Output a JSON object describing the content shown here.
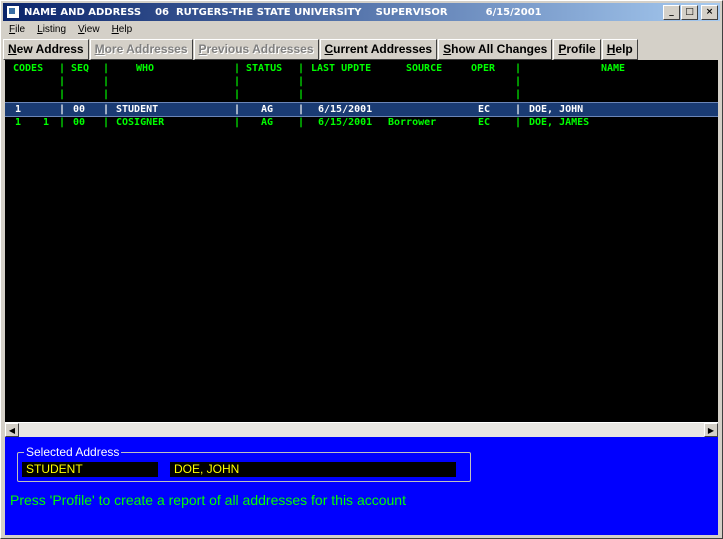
{
  "window": {
    "title_segments": [
      "NAME AND ADDRESS",
      "06  RUTGERS-THE STATE UNIVERSITY",
      "SUPERVISOR",
      "6/15/2001"
    ],
    "controls": {
      "minimize": "_",
      "maximize": "□",
      "close": "×"
    }
  },
  "menu": {
    "items": [
      {
        "u": "F",
        "rest": "ile"
      },
      {
        "u": "L",
        "rest": "isting"
      },
      {
        "u": "V",
        "rest": "iew"
      },
      {
        "u": "H",
        "rest": "elp"
      }
    ]
  },
  "toolbar": {
    "buttons": [
      {
        "u": "N",
        "rest": "ew Address",
        "enabled": true
      },
      {
        "u": "M",
        "rest": "ore Addresses",
        "enabled": false
      },
      {
        "u": "P",
        "rest": "revious Addresses",
        "enabled": false
      },
      {
        "u": "C",
        "rest": "urrent Addresses",
        "enabled": true
      },
      {
        "u": "S",
        "rest": "how All Changes",
        "enabled": true
      },
      {
        "u": "P",
        "rest": "rofile",
        "enabled": true
      },
      {
        "u": "H",
        "rest": "elp",
        "enabled": true
      }
    ]
  },
  "table": {
    "headers": {
      "codes": "CODES",
      "seq": "SEQ",
      "who": "WHO",
      "status": "STATUS",
      "last_update": "LAST UPDTE",
      "source": "SOURCE",
      "oper": "OPER",
      "name": "NAME"
    },
    "separator": "|",
    "rows": [
      {
        "code1": "1",
        "code2": "",
        "seq": "00",
        "who": "STUDENT",
        "status": "AG",
        "last_update": "6/15/2001",
        "source": "",
        "oper": "EC",
        "name": "DOE, JOHN",
        "selected": true
      },
      {
        "code1": "1",
        "code2": "1",
        "seq": "00",
        "who": "COSIGNER",
        "status": "AG",
        "last_update": "6/15/2001",
        "source": "Borrower",
        "oper": "EC",
        "name": "DOE, JAMES",
        "selected": false
      }
    ]
  },
  "selected_address": {
    "legend": "Selected Address",
    "who": "STUDENT",
    "name": "DOE, JOHN"
  },
  "hint": "Press 'Profile' to create a report of all addresses for this account",
  "colors": {
    "terminal_bg": "#000000",
    "terminal_text": "#00ff00",
    "panel_bg": "#0000ff",
    "selected_row": "#1a3b73",
    "field_text": "#ffff00"
  }
}
